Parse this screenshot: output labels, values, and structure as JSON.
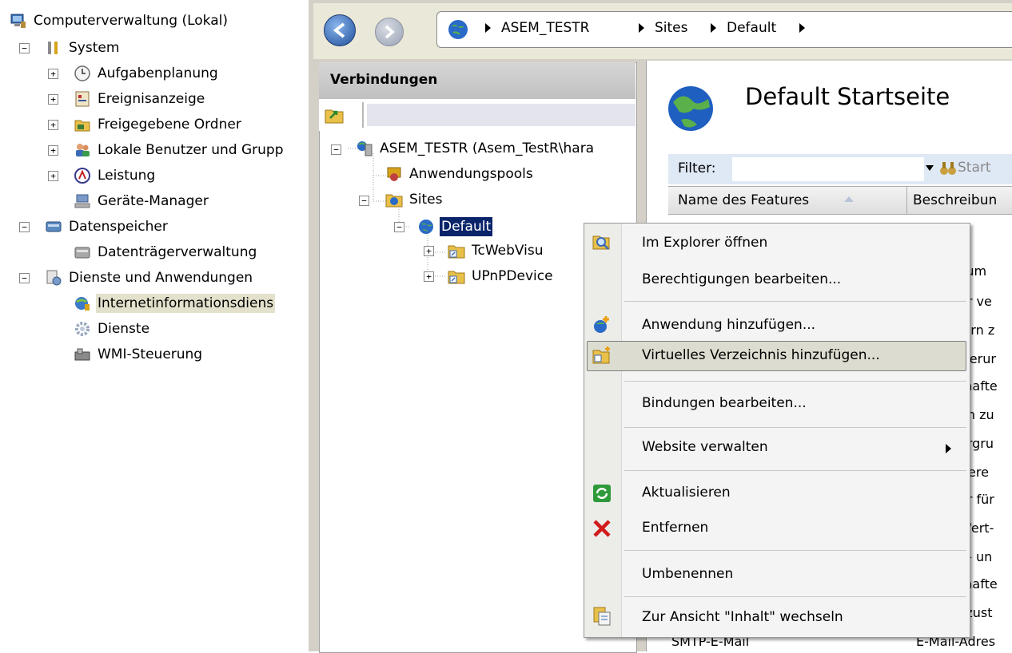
{
  "computer_management": {
    "root": "Computerverwaltung (Lokal)",
    "system": "System",
    "task_scheduler": "Aufgabenplanung",
    "event_viewer": "Ereignisanzeige",
    "shared_folders": "Freigegebene Ordner",
    "local_users": "Lokale Benutzer und Grupp",
    "performance": "Leistung",
    "device_manager": "Geräte-Manager",
    "storage": "Datenspeicher",
    "disk_management": "Datenträgerverwaltung",
    "services_apps": "Dienste und Anwendungen",
    "iis": "Internetinformationsdiens",
    "services": "Dienste",
    "wmi": "WMI-Steuerung",
    "expander_plus": "+",
    "expander_minus": "−"
  },
  "breadcrumb": [
    "ASEM_TESTR",
    "Sites",
    "Default"
  ],
  "connections": {
    "header": "Verbindungen",
    "server": "ASEM_TESTR (Asem_TestR\\hara",
    "app_pools": "Anwendungspools",
    "sites": "Sites",
    "default_site": "Default",
    "child_1": "TcWebVisu",
    "child_2": "UPnPDevice"
  },
  "main": {
    "title": "Default Startseite",
    "filter_label": "Filter:",
    "start_button": "Start",
    "col_name": "Name des Features",
    "col_desc": "Beschreibun",
    "row_partials": [
      "zum",
      "er ve",
      "lern z",
      "sierur",
      "thafte",
      "en zu",
      "ergru",
      "riere",
      "er für",
      "Wert-",
      "g- un",
      "thafte",
      "szust"
    ],
    "bottom_row_name": "SMTP-E-Mail",
    "bottom_row_desc": "E-Mail-Adres"
  },
  "context_menu": {
    "items": [
      "Im Explorer öffnen",
      "Berechtigungen bearbeiten...",
      "Anwendung hinzufügen...",
      "Virtuelles Verzeichnis hinzufügen...",
      "Bindungen bearbeiten...",
      "Website verwalten",
      "Aktualisieren",
      "Entfernen",
      "Umbenennen",
      "Zur Ansicht \"Inhalt\" wechseln"
    ],
    "highlighted_index": 3
  },
  "colors": {
    "selection_blue": "#0a246a",
    "tree_select_grey": "#e3e1cc",
    "menu_highlight": "#dcdcd0",
    "remove_red": "#d11a1a",
    "refresh_green": "#2e9a3a"
  }
}
